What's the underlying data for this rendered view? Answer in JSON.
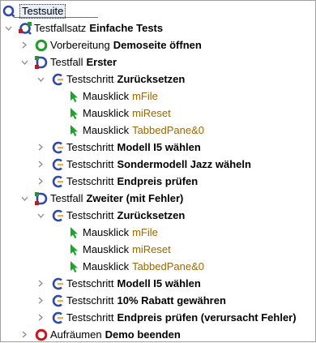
{
  "root": {
    "label": "Testsuite"
  },
  "items": {
    "set": {
      "kind": "Testfallsatz",
      "name": "Einfache Tests"
    },
    "prep": {
      "kind": "Vorbereitung",
      "name": "Demoseite öffnen"
    },
    "tc1": {
      "kind": "Testfall",
      "name": "Erster"
    },
    "tc1_s1": {
      "kind": "Testschritt",
      "name": "Zurücksetzen"
    },
    "tc1_s1_c1": {
      "kind": "Mausklick",
      "comp": "mFile"
    },
    "tc1_s1_c2": {
      "kind": "Mausklick",
      "comp": "miReset"
    },
    "tc1_s1_c3": {
      "kind": "Mausklick",
      "comp": "TabbedPane&0"
    },
    "tc1_s2": {
      "kind": "Testschritt",
      "name": "Modell I5 wählen"
    },
    "tc1_s3": {
      "kind": "Testschritt",
      "name": "Sondermodell Jazz wäheln"
    },
    "tc1_s4": {
      "kind": "Testschritt",
      "name": "Endpreis prüfen"
    },
    "tc2": {
      "kind": "Testfall",
      "name": "Zweiter (mit Fehler)"
    },
    "tc2_s1": {
      "kind": "Testschritt",
      "name": "Zurücksetzen"
    },
    "tc2_s1_c1": {
      "kind": "Mausklick",
      "comp": "mFile"
    },
    "tc2_s1_c2": {
      "kind": "Mausklick",
      "comp": "miReset"
    },
    "tc2_s1_c3": {
      "kind": "Mausklick",
      "comp": "TabbedPane&0"
    },
    "tc2_s2": {
      "kind": "Testschritt",
      "name": "Modell I5 wählen"
    },
    "tc2_s3": {
      "kind": "Testschritt",
      "name": "10% Rabatt gewähren"
    },
    "tc2_s4": {
      "kind": "Testschritt",
      "name": "Endpreis prüfen (verursacht Fehler)"
    },
    "cleanup": {
      "kind": "Aufräumen",
      "name": "Demo beenden"
    }
  },
  "colors": {
    "component_text": "#9a6700",
    "procedure_blue": "#2e4aa8",
    "procedure_accent": "#e8b33a",
    "setup_green": "#1f9b2b",
    "cleanup_red": "#c8161d",
    "click_green": "#1aa52a"
  },
  "icons": {
    "root": "testsuite-icon",
    "set": "testset-icon",
    "prep": "setup-icon",
    "testcase": "testcase-icon",
    "step": "teststep-icon",
    "click": "mouse-pointer-icon",
    "cleanup": "cleanup-icon"
  }
}
